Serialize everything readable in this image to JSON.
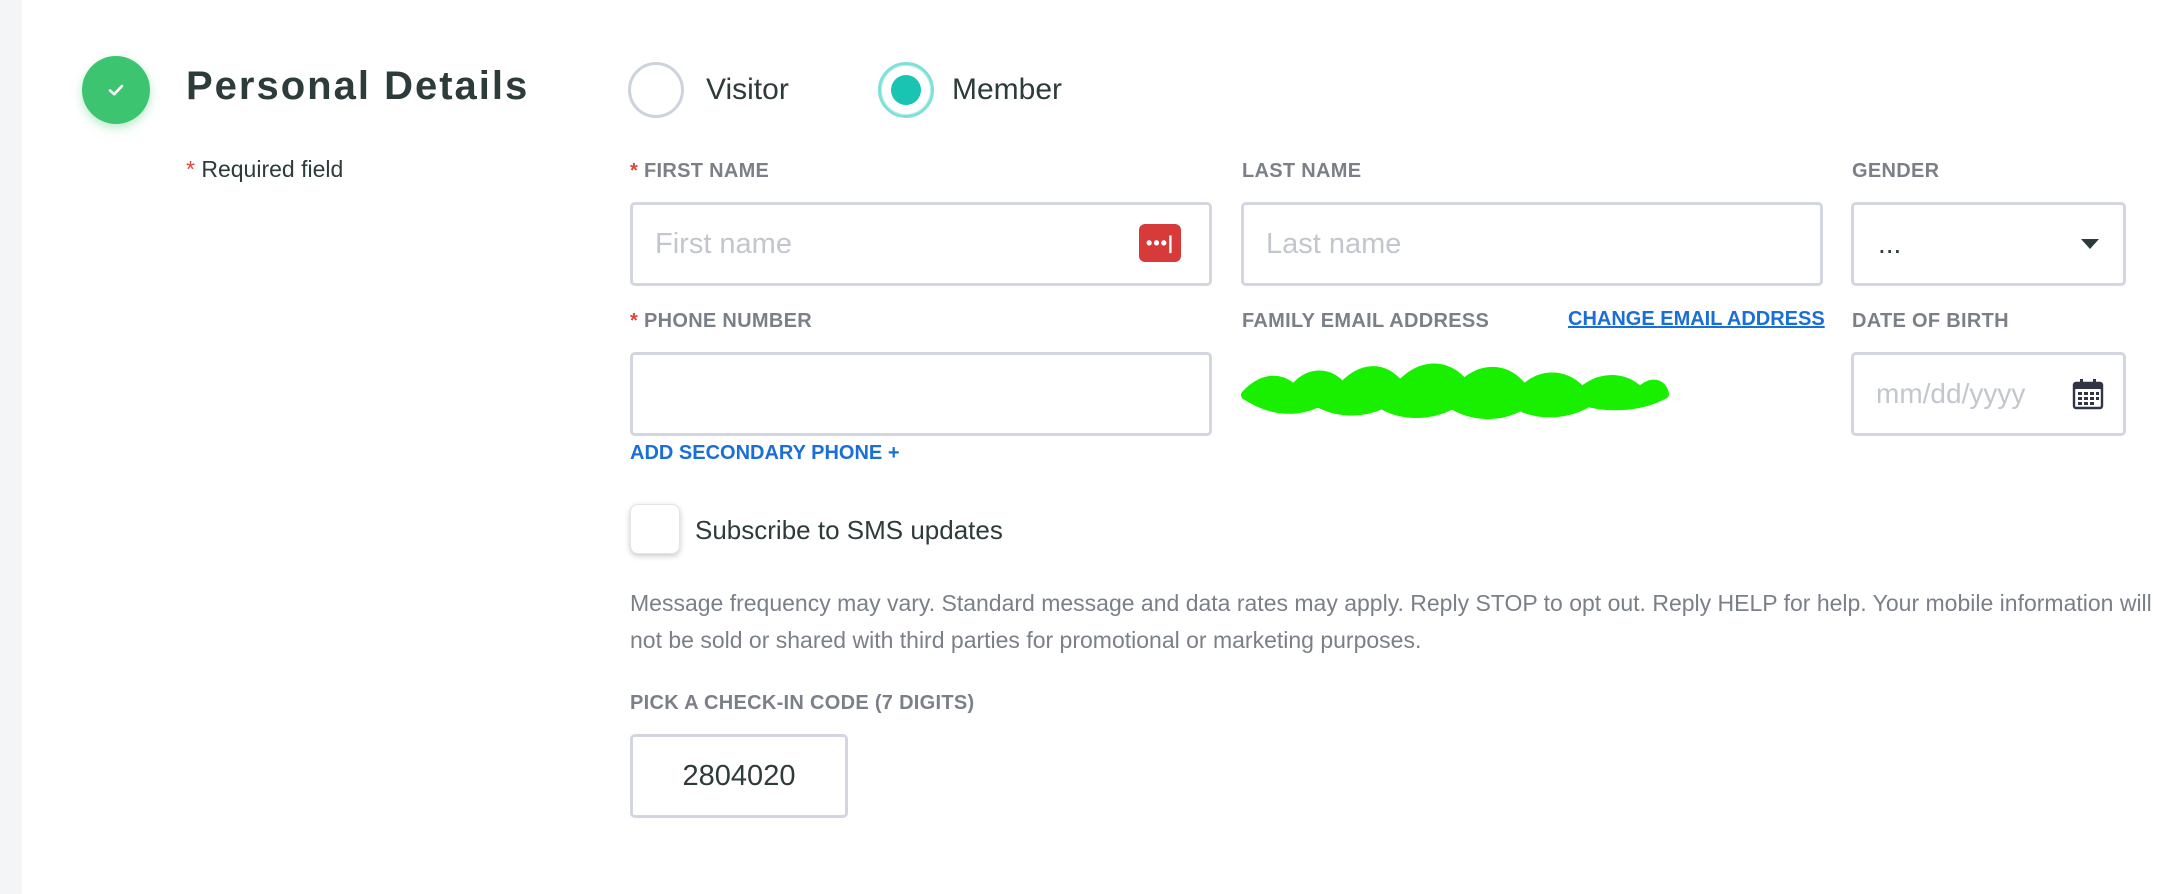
{
  "section": {
    "title": "Personal Details",
    "required_star": "*",
    "required_note": "Required field"
  },
  "member_type": {
    "options": [
      {
        "label": "Visitor",
        "selected": false
      },
      {
        "label": "Member",
        "selected": true
      }
    ]
  },
  "fields": {
    "first_name": {
      "label": "FIRST NAME",
      "placeholder": "First name",
      "required": true
    },
    "last_name": {
      "label": "LAST NAME",
      "placeholder": "Last name"
    },
    "gender": {
      "label": "GENDER",
      "value": "..."
    },
    "phone": {
      "label": "PHONE NUMBER",
      "value": "",
      "required": true
    },
    "family_email": {
      "label": "FAMILY EMAIL ADDRESS",
      "change_link": "CHANGE EMAIL ADDRESS"
    },
    "dob": {
      "label": "DATE OF BIRTH",
      "placeholder": "mm/dd/yyyy"
    },
    "checkin_code": {
      "label": "PICK A CHECK-IN CODE (7 DIGITS)",
      "value": "2804020"
    }
  },
  "add_secondary_phone": "ADD SECONDARY PHONE +",
  "sms": {
    "label": "Subscribe to SMS updates",
    "checked": false,
    "disclaimer": "Message frequency may vary. Standard message and data rates may apply. Reply STOP to opt out. Reply HELP for help. Your mobile information will not be sold or shared with third parties for promotional or marketing purposes."
  },
  "icons": {
    "step": "check-icon",
    "password_manager": "password-manager-icon",
    "gender_caret": "caret-down-icon",
    "calendar": "calendar-icon"
  },
  "colors": {
    "accent_green": "#3cc470",
    "radio_teal": "#19c4b3",
    "required_red": "#e0443a",
    "link_blue": "#1a6fd6",
    "redaction_green": "#19f000"
  }
}
